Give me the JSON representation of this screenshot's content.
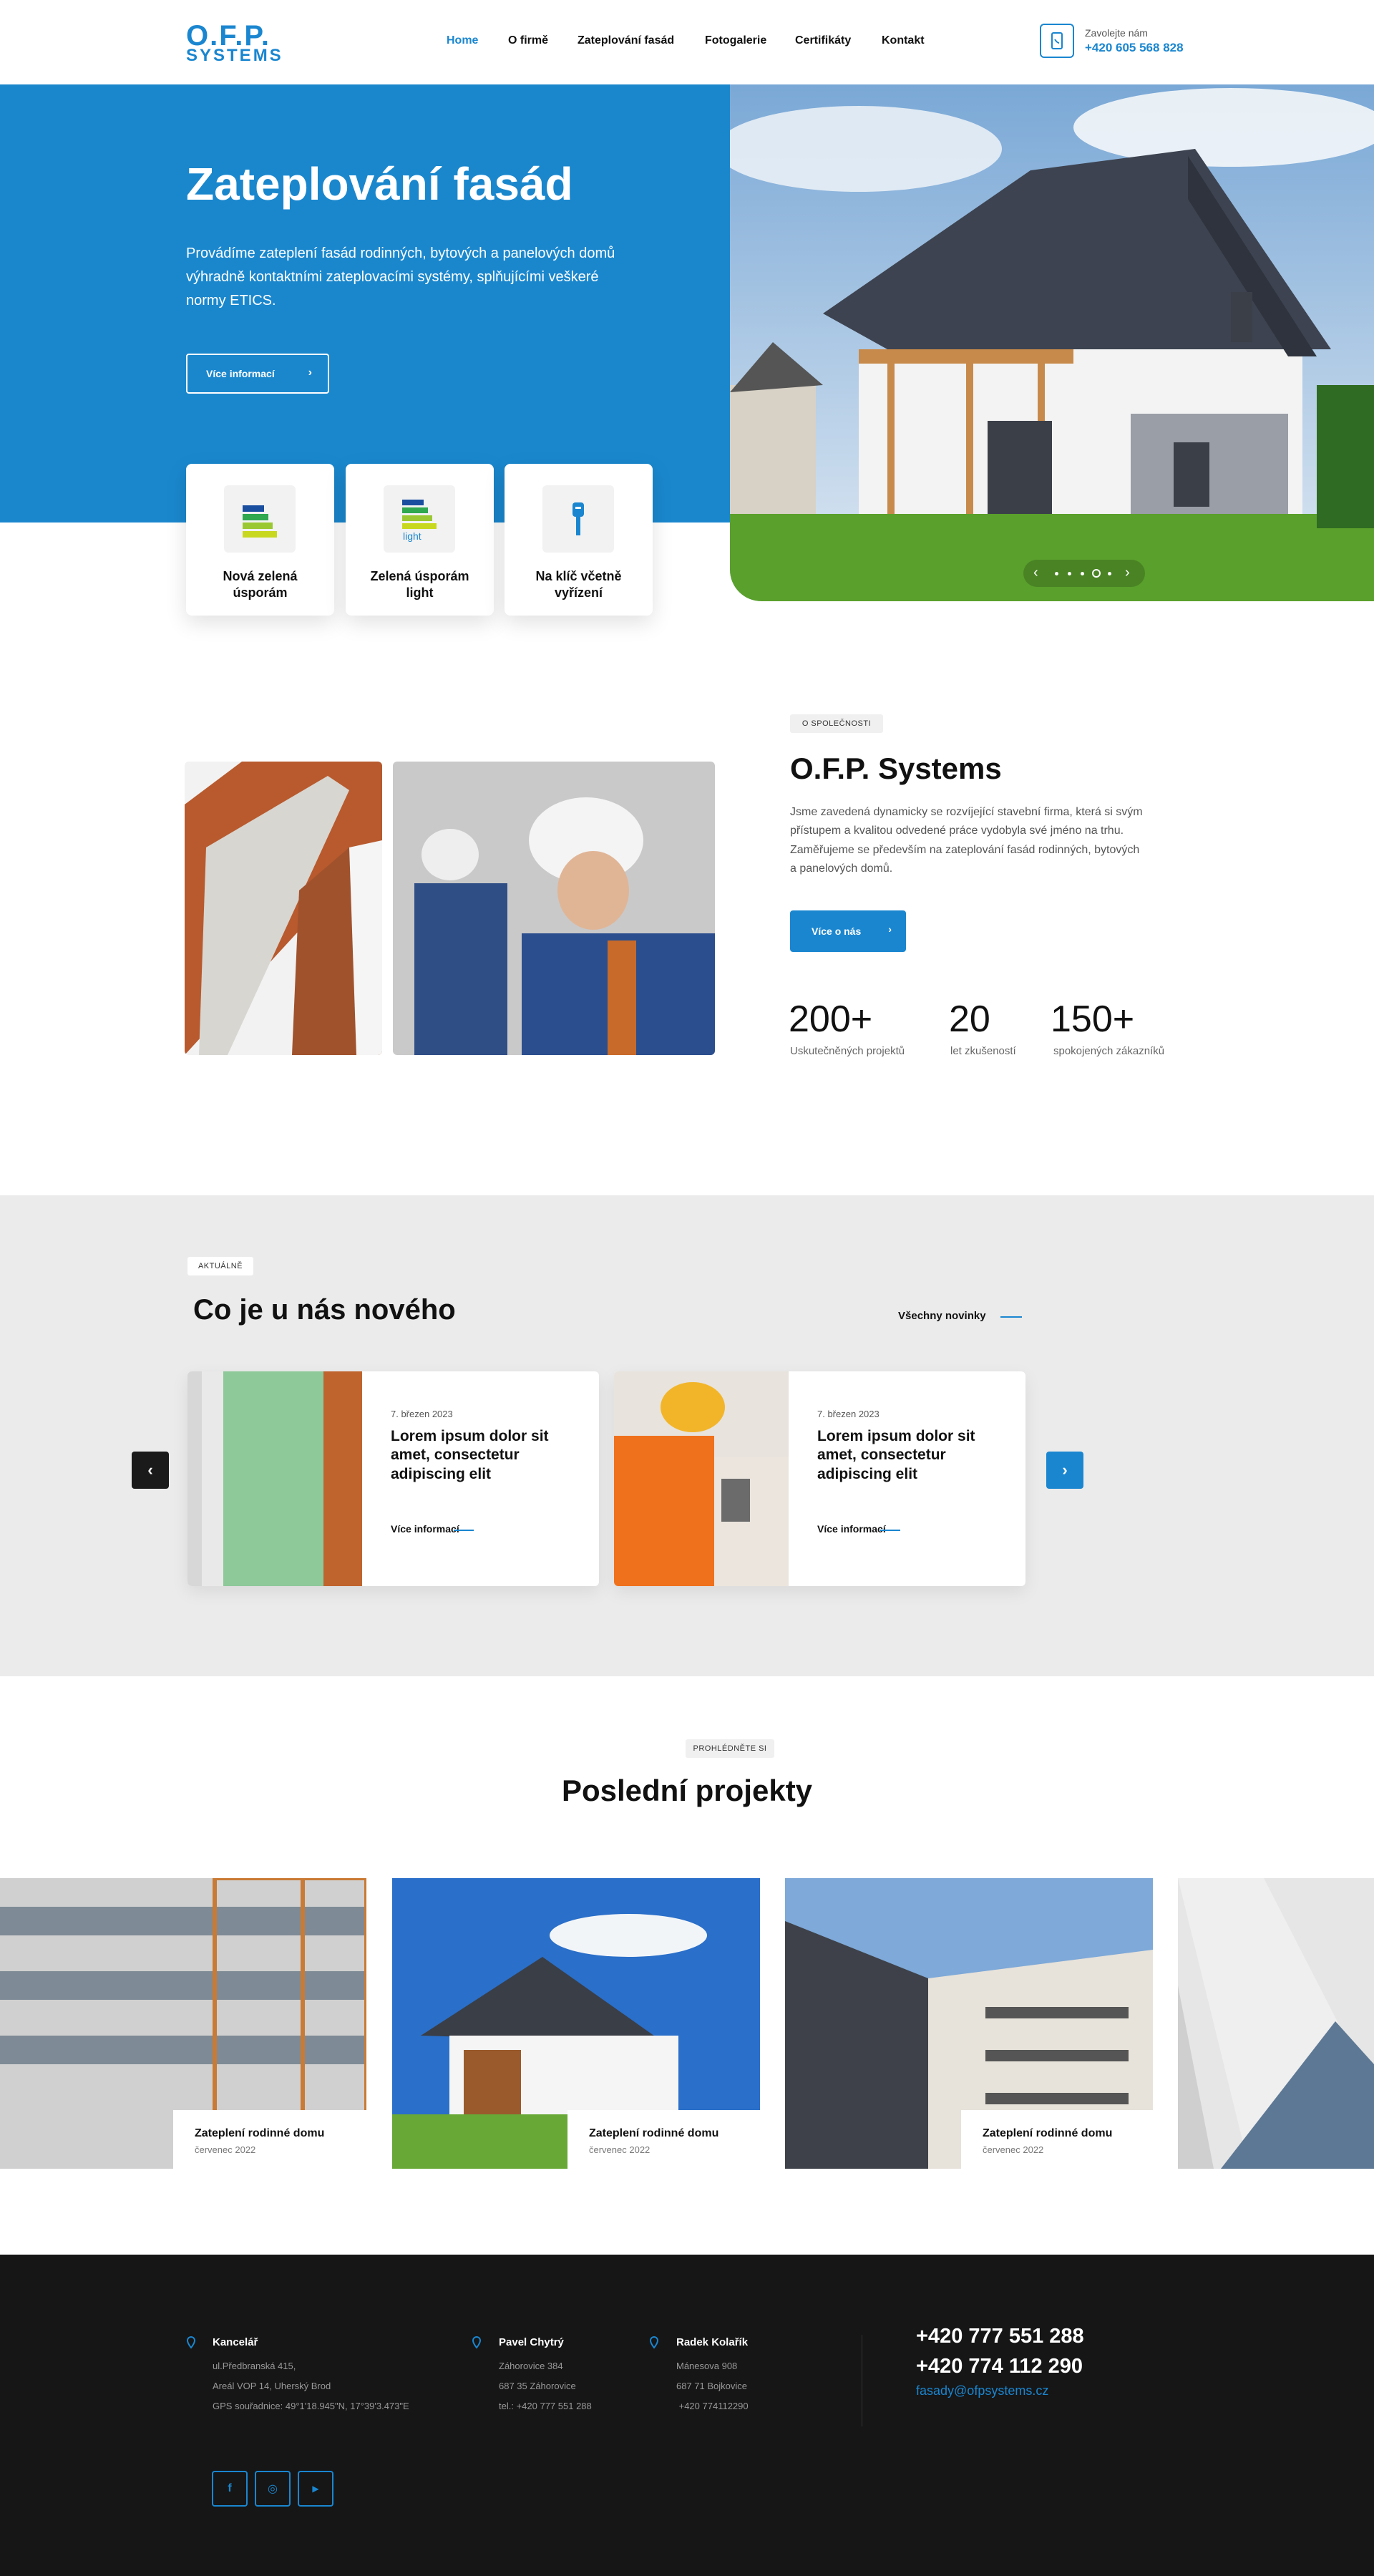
{
  "header": {
    "logo_line1": "O.F.P.",
    "logo_line2": "SYSTEMS",
    "nav": [
      "Home",
      "O firmě",
      "Zateplování fasád",
      "Fotogalerie",
      "Certifikáty",
      "Kontakt"
    ],
    "active_nav": "Home",
    "call_label": "Zavolejte nám",
    "call_number": "+420 605 568 828"
  },
  "hero": {
    "title": "Zateplování fasád",
    "text": "Provádíme zateplení fasád rodinných, bytových a panelových domů výhradně kontaktními zateplovacími systémy, splňujícími veškeré normy ETICS.",
    "button": "Více informací",
    "cards": [
      {
        "label": "Nová zelená úsporám",
        "icon": "energy-label-icon"
      },
      {
        "label": "Zelená úsporám light",
        "icon": "energy-label-light-icon",
        "icon_text": "light"
      },
      {
        "label": "Na klíč včetně vyřízení",
        "icon": "key-icon"
      }
    ],
    "slider": {
      "count": 5,
      "active": 4
    }
  },
  "about": {
    "tag": "O SPOLEČNOSTI",
    "title": "O.F.P. Systems",
    "text": "Jsme zavedená dynamicky se rozvíjející stavební firma, která si svým přístupem a kvalitou odvedené práce vydobyla své jméno na trhu. Zaměřujeme se především na zateplování fasád rodinných, bytových a panelových domů.",
    "button": "Více o nás",
    "stats": [
      {
        "value": "200+",
        "label": "Uskutečněných projektů"
      },
      {
        "value": "20",
        "label": "let zkušeností"
      },
      {
        "value": "150+",
        "label": "spokojených zákazníků"
      }
    ]
  },
  "news": {
    "tag": "AKTUÁLNĚ",
    "title": "Co je u nás nového",
    "all_link": "Všechny novinky",
    "items": [
      {
        "date": "7. březen 2023",
        "title": "Lorem ipsum dolor sit amet, consectetur adipiscing elit",
        "more": "Více informací"
      },
      {
        "date": "7. březen 2023",
        "title": "Lorem ipsum dolor sit amet, consectetur adipiscing elit",
        "more": "Více informací"
      }
    ],
    "prev": "‹",
    "next": "›"
  },
  "projects": {
    "tag": "PROHLÉDNĚTE SI",
    "title": "Poslední projekty",
    "items": [
      {
        "title": "Zateplení rodinné domu",
        "date": "červenec 2022"
      },
      {
        "title": "Zateplení rodinné domu",
        "date": "červenec 2022"
      },
      {
        "title": "Zateplení rodinné domu",
        "date": "červenec 2022"
      }
    ]
  },
  "footer": {
    "offices": [
      {
        "name": "Kancelář",
        "lines": [
          "ul.Předbranská 415,",
          "Areál VOP 14, Uherský Brod",
          "GPS souřadnice: 49°1'18.945\"N, 17°39'3.473\"E"
        ]
      },
      {
        "name": "Pavel Chytrý",
        "lines": [
          "Záhorovice 384",
          "687 35 Záhorovice",
          "tel.: +420 777 551 288"
        ]
      },
      {
        "name": "Radek Kolařík",
        "lines": [
          "Mánesova 908",
          "687 71 Bojkovice",
          " +420 774112290"
        ]
      }
    ],
    "phones": [
      "+420 777 551 288",
      "+420 774 112 290"
    ],
    "email": "fasady@ofpsystems.cz",
    "social": [
      {
        "name": "facebook-icon",
        "glyph": "f"
      },
      {
        "name": "instagram-icon",
        "glyph": "◎"
      },
      {
        "name": "youtube-icon",
        "glyph": "▶"
      }
    ]
  },
  "colors": {
    "accent": "#1a86d0",
    "dark": "#161616",
    "hero_blue": "#1a87cd"
  }
}
